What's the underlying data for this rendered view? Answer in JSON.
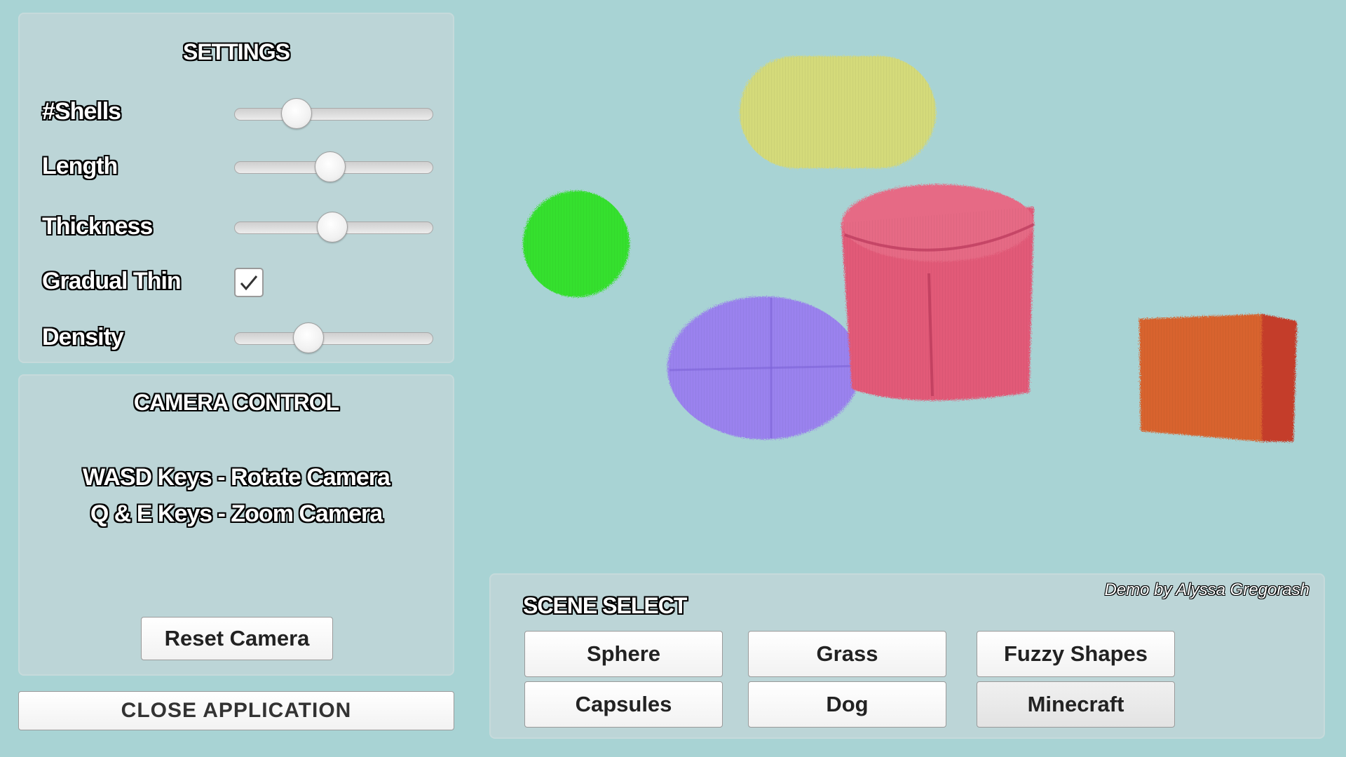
{
  "settings": {
    "title": "SETTINGS",
    "shells": {
      "label": "#Shells",
      "value": 0.28
    },
    "length": {
      "label": "Length",
      "value": 0.48
    },
    "thickness": {
      "label": "Thickness",
      "value": 0.49
    },
    "gradual_thin": {
      "label": "Gradual Thin",
      "checked": true
    },
    "density": {
      "label": "Density",
      "value": 0.35
    }
  },
  "camera": {
    "title": "CAMERA CONTROL",
    "hint_rotate": "WASD Keys - Rotate Camera",
    "hint_zoom": "Q & E Keys - Zoom Camera",
    "reset_label": "Reset Camera"
  },
  "close_label": "CLOSE APPLICATION",
  "scene": {
    "title": "SCENE SELECT",
    "credit": "Demo by Alyssa Gregorash",
    "buttons": [
      "Sphere",
      "Grass",
      "Fuzzy Shapes",
      "Capsules",
      "Dog",
      "Minecraft"
    ],
    "selected": "Minecraft"
  },
  "viewport": {
    "objects": [
      {
        "name": "capsule",
        "color": "#d4da7a"
      },
      {
        "name": "sphere-green",
        "color": "#36e02e"
      },
      {
        "name": "cylinder",
        "color": "#e25a78"
      },
      {
        "name": "ellipsoid",
        "color": "#9a82ee"
      },
      {
        "name": "cube",
        "color": "#d8642e"
      }
    ]
  }
}
